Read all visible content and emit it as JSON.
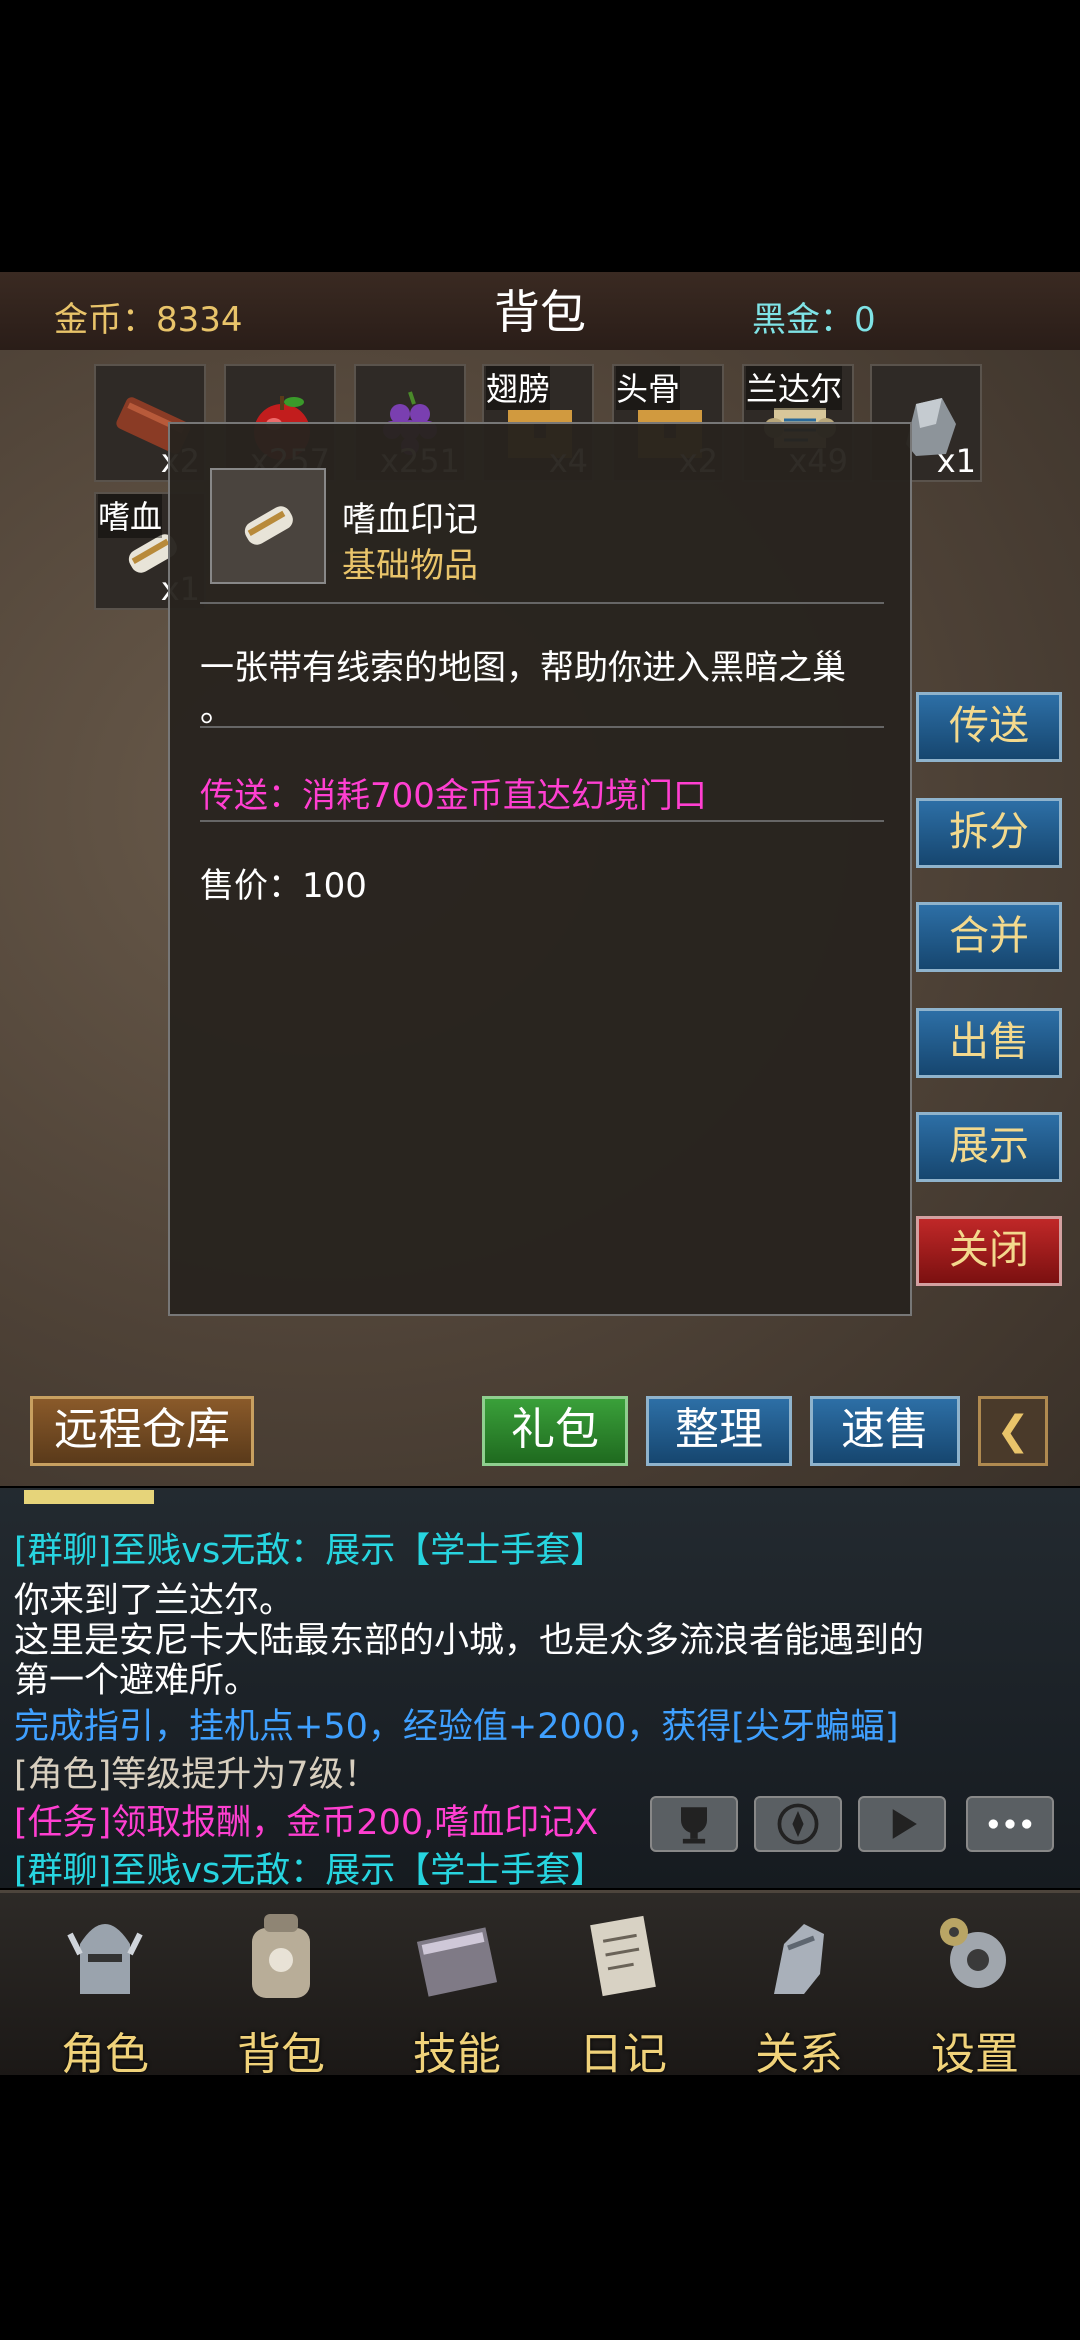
{
  "header": {
    "title": "背包",
    "gold_label": "金币：8334",
    "blackgold_label": "黑金：0"
  },
  "inventory": {
    "slots": [
      {
        "name": "",
        "count": "x2",
        "icon": "wood-log-icon"
      },
      {
        "name": "",
        "count": "x257",
        "icon": "apple-icon"
      },
      {
        "name": "",
        "count": "x251",
        "icon": "grapes-icon"
      },
      {
        "name": "翅膀",
        "count": "x4",
        "icon": "chest-icon"
      },
      {
        "name": "头骨",
        "count": "x2",
        "icon": "chest-icon"
      },
      {
        "name": "兰达尔",
        "count": "x49",
        "icon": "scroll-icon"
      },
      {
        "name": "",
        "count": "x1",
        "icon": "ore-icon"
      },
      {
        "name": "嗜血",
        "count": "x1",
        "icon": "scroll-icon"
      }
    ]
  },
  "detail": {
    "item_name": "嗜血印记",
    "item_type": "基础物品",
    "description_line1": "一张带有线索的地图，帮助你进入黑暗之巢",
    "description_line2": "。",
    "teleport_text": "传送：消耗700金币直达幻境门口",
    "price": "售价：100"
  },
  "side_buttons": {
    "teleport": "传送",
    "split": "拆分",
    "merge": "合并",
    "sell": "出售",
    "show": "展示",
    "close": "关闭"
  },
  "bag_buttons": {
    "warehouse": "远程仓库",
    "gift": "礼包",
    "sort": "整理",
    "quick_sell": "速售"
  },
  "chat": {
    "lines": [
      "[群聊]至贱vs无敌：展示【学士手套】",
      "你来到了兰达尔。",
      "这里是安尼卡大陆最东部的小城，也是众多流浪者能遇到的",
      "第一个避难所。",
      "完成指引，挂机点+50，经验值+2000，获得[尖牙蝙蝠]",
      "[角色]等级提升为7级！",
      "[任务]领取报酬，金币200,嗜血印记X",
      "[群聊]至贱vs无敌：展示【学士手套】"
    ],
    "colors": [
      "#27d5e0",
      "#ffffff",
      "#ffffff",
      "#ffffff",
      "#3fa0ff",
      "#d8cfbf",
      "#ff3fd1",
      "#27d5e0"
    ]
  },
  "nav": {
    "items": [
      "角色",
      "背包",
      "技能",
      "日记",
      "关系",
      "设置"
    ]
  },
  "colors": {
    "gold": "#e9c46a",
    "cyan": "#7fe3e6",
    "magenta": "#ff3fd1",
    "blue_button": "#2d6fa6",
    "red_button": "#c02828"
  }
}
